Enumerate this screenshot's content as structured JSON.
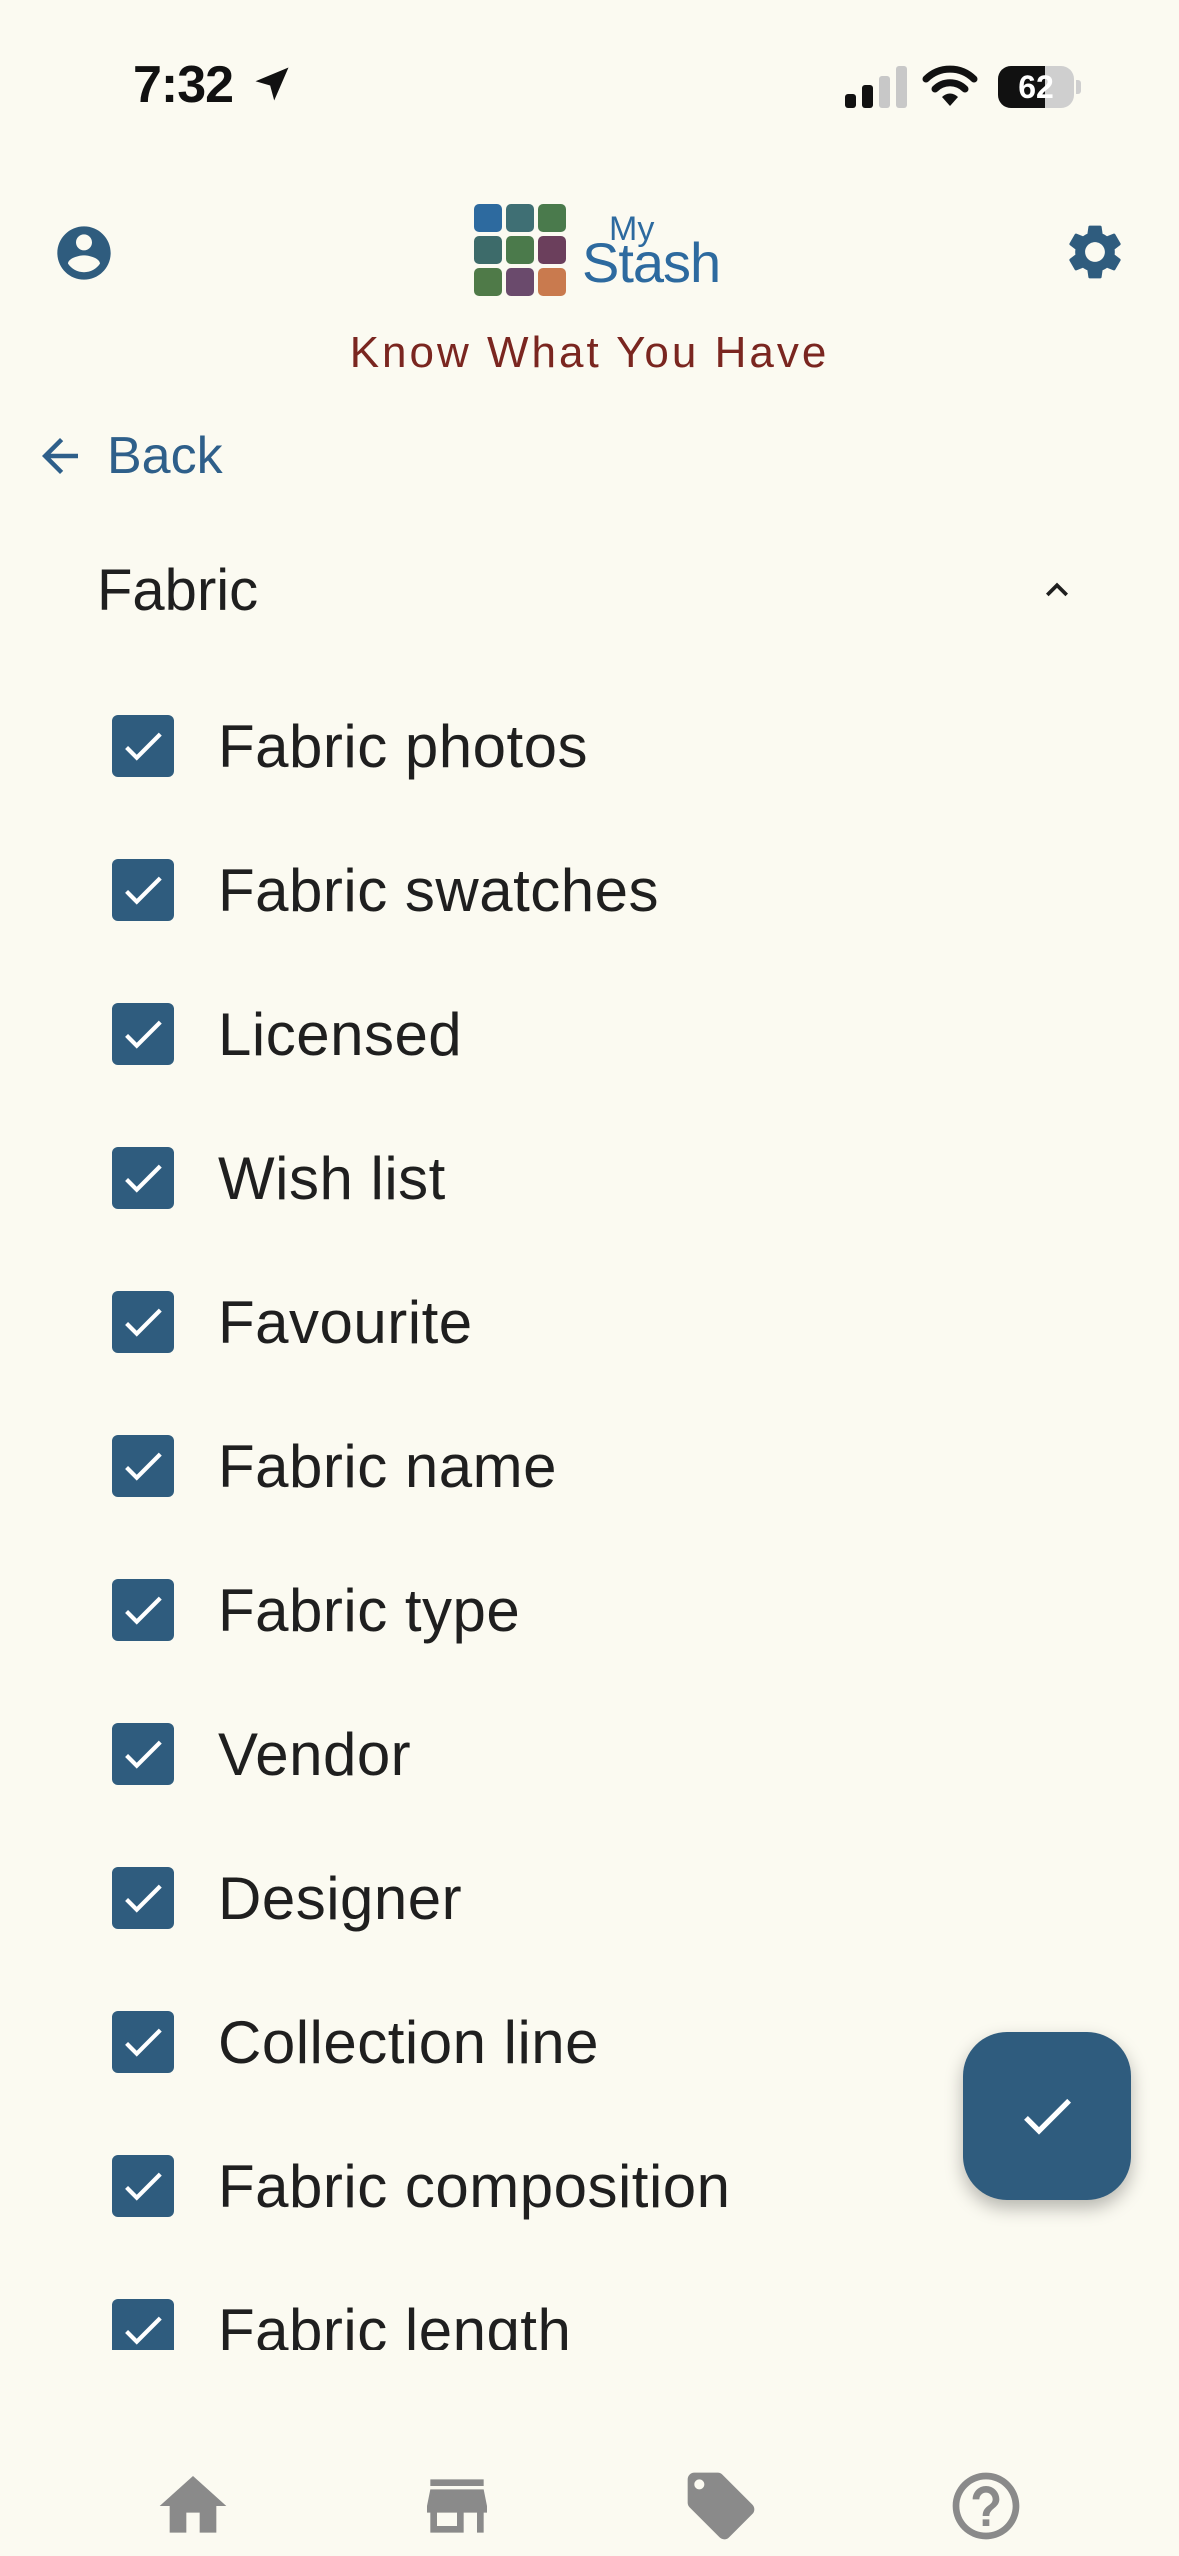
{
  "status_bar": {
    "time": "7:32",
    "battery": "62",
    "battery_level": 0.62,
    "icons": [
      "location-arrow-icon",
      "cellular-signal-icon",
      "wifi-icon",
      "battery-icon"
    ]
  },
  "header": {
    "logo_my": "My",
    "logo_stash": "Stash",
    "tagline": "Know What You Have",
    "profile_icon": "account-circle-icon",
    "settings_icon": "gear-icon",
    "logo_colors": [
      "#2d6a9f",
      "#3f6f74",
      "#4a7a4c",
      "#3d6b6a",
      "#4b7a4b",
      "#6b3f5c",
      "#4f7a48",
      "#6a4a6c",
      "#c97a4e"
    ]
  },
  "nav": {
    "back_label": "Back"
  },
  "section": {
    "title": "Fabric",
    "expanded": true,
    "items": [
      {
        "label": "Fabric photos",
        "checked": true
      },
      {
        "label": "Fabric swatches",
        "checked": true
      },
      {
        "label": "Licensed",
        "checked": true
      },
      {
        "label": "Wish list",
        "checked": true
      },
      {
        "label": "Favourite",
        "checked": true
      },
      {
        "label": "Fabric name",
        "checked": true
      },
      {
        "label": "Fabric type",
        "checked": true
      },
      {
        "label": "Vendor",
        "checked": true
      },
      {
        "label": "Designer",
        "checked": true
      },
      {
        "label": "Collection line",
        "checked": true
      },
      {
        "label": "Fabric composition",
        "checked": true
      },
      {
        "label": "Fabric length",
        "checked": true
      }
    ]
  },
  "fab": {
    "icon": "check-icon"
  },
  "bottom_nav": {
    "items": [
      "home-icon",
      "store-icon",
      "tag-icon",
      "help-icon"
    ]
  },
  "colors": {
    "background": "#fbfaf1",
    "primary": "#2f5c7e",
    "tagline": "#7a2620",
    "nav_icon": "#8a8a8a"
  }
}
